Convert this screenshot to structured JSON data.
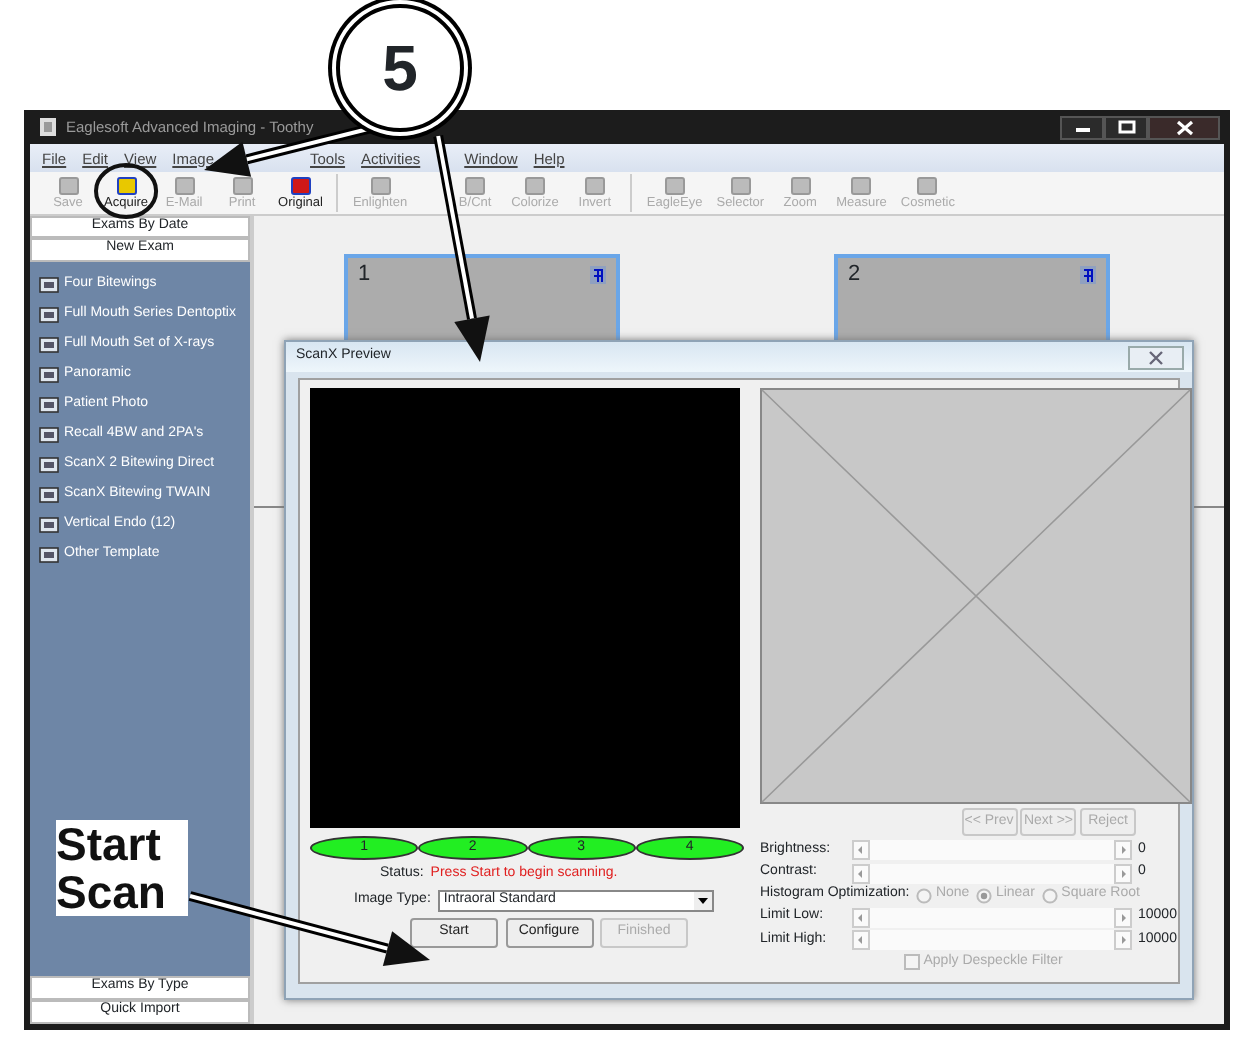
{
  "callouts": [
    {
      "kind": "number",
      "text": "5"
    },
    {
      "kind": "label",
      "text": "Start Scan"
    }
  ],
  "window": {
    "title": "Eaglesoft Advanced Imaging - Toothy"
  },
  "menu": [
    "File",
    "Edit",
    "View",
    "Image",
    "Tools",
    "Activities",
    "Window",
    "Help"
  ],
  "toolbar": [
    {
      "label": "Save",
      "disabled": true
    },
    {
      "label": "Acquire",
      "disabled": false
    },
    {
      "label": "E-Mail",
      "disabled": true
    },
    {
      "label": "Print",
      "disabled": true
    },
    {
      "label": "Original",
      "disabled": false
    },
    {
      "label": "Enlighten",
      "disabled": true
    },
    {
      "label": "B/Cnt",
      "disabled": true
    },
    {
      "label": "Colorize",
      "disabled": true
    },
    {
      "label": "Invert",
      "disabled": true
    },
    {
      "label": "EagleEye",
      "disabled": true
    },
    {
      "label": "Selector",
      "disabled": true
    },
    {
      "label": "Zoom",
      "disabled": true
    },
    {
      "label": "Measure",
      "disabled": true
    },
    {
      "label": "Cosmetic",
      "disabled": true
    }
  ],
  "sidebar": {
    "header": "Exams By Date",
    "new_button": "New Exam",
    "items": [
      "Four Bitewings",
      "Full Mouth Series Dentoptix",
      "Full Mouth Set of X-rays",
      "Panoramic",
      "Patient Photo",
      "Recall 4BW and 2PA's",
      "ScanX 2 Bitewing Direct",
      "ScanX Bitewing TWAIN",
      "Vertical Endo (12)",
      "Other Template"
    ],
    "footer": [
      "Exams By Type",
      "Quick Import"
    ]
  },
  "slots": [
    "1",
    "2"
  ],
  "dialog": {
    "title": "ScanX Preview",
    "nav_buttons": [
      {
        "label": "<< Prev",
        "disabled": true
      },
      {
        "label": "Next >>",
        "disabled": true
      },
      {
        "label": "Reject",
        "disabled": true
      }
    ],
    "sensors": [
      "1",
      "2",
      "3",
      "4"
    ],
    "status_label": "Status:",
    "status": "Press Start to begin scanning.",
    "image_type_label": "Image Type:",
    "image_type": "Intraoral Standard",
    "buttons": [
      {
        "label": "Start",
        "disabled": false
      },
      {
        "label": "Configure",
        "disabled": false
      },
      {
        "label": "Finished",
        "disabled": true
      }
    ],
    "adjustments_top": [
      {
        "label": "Brightness:",
        "reading": "0"
      },
      {
        "label": "Contrast:",
        "reading": "0"
      }
    ],
    "histogram": {
      "label": "Histogram Optimization:",
      "options": [
        {
          "label": "None",
          "selected": false
        },
        {
          "label": "Linear",
          "selected": true
        },
        {
          "label": "Square Root",
          "selected": false
        }
      ]
    },
    "adjustments_bottom": [
      {
        "label": "Limit Low:",
        "reading": "10000"
      },
      {
        "label": "Limit High:",
        "reading": "10000"
      }
    ],
    "despeckle": {
      "label": "Apply Despeckle Filter",
      "checked": false,
      "disabled": true
    }
  }
}
